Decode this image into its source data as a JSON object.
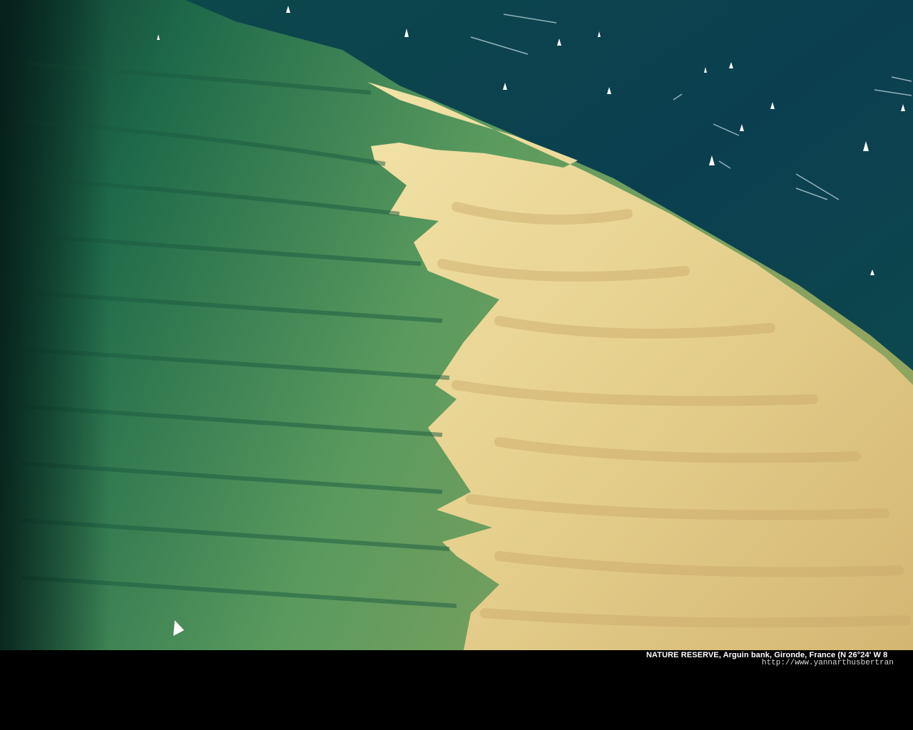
{
  "caption": {
    "title": "NATURE RESERVE, Arguin bank, Gironde, France (N 26°24' W 8",
    "url": "http://www.yannarthusbertran"
  },
  "colors": {
    "deep_sea": "#0b3f4a",
    "shallow_water": "#3f8a5c",
    "sand": "#e8d79a",
    "caption_background": "#000000",
    "caption_text": "#ffffff"
  }
}
